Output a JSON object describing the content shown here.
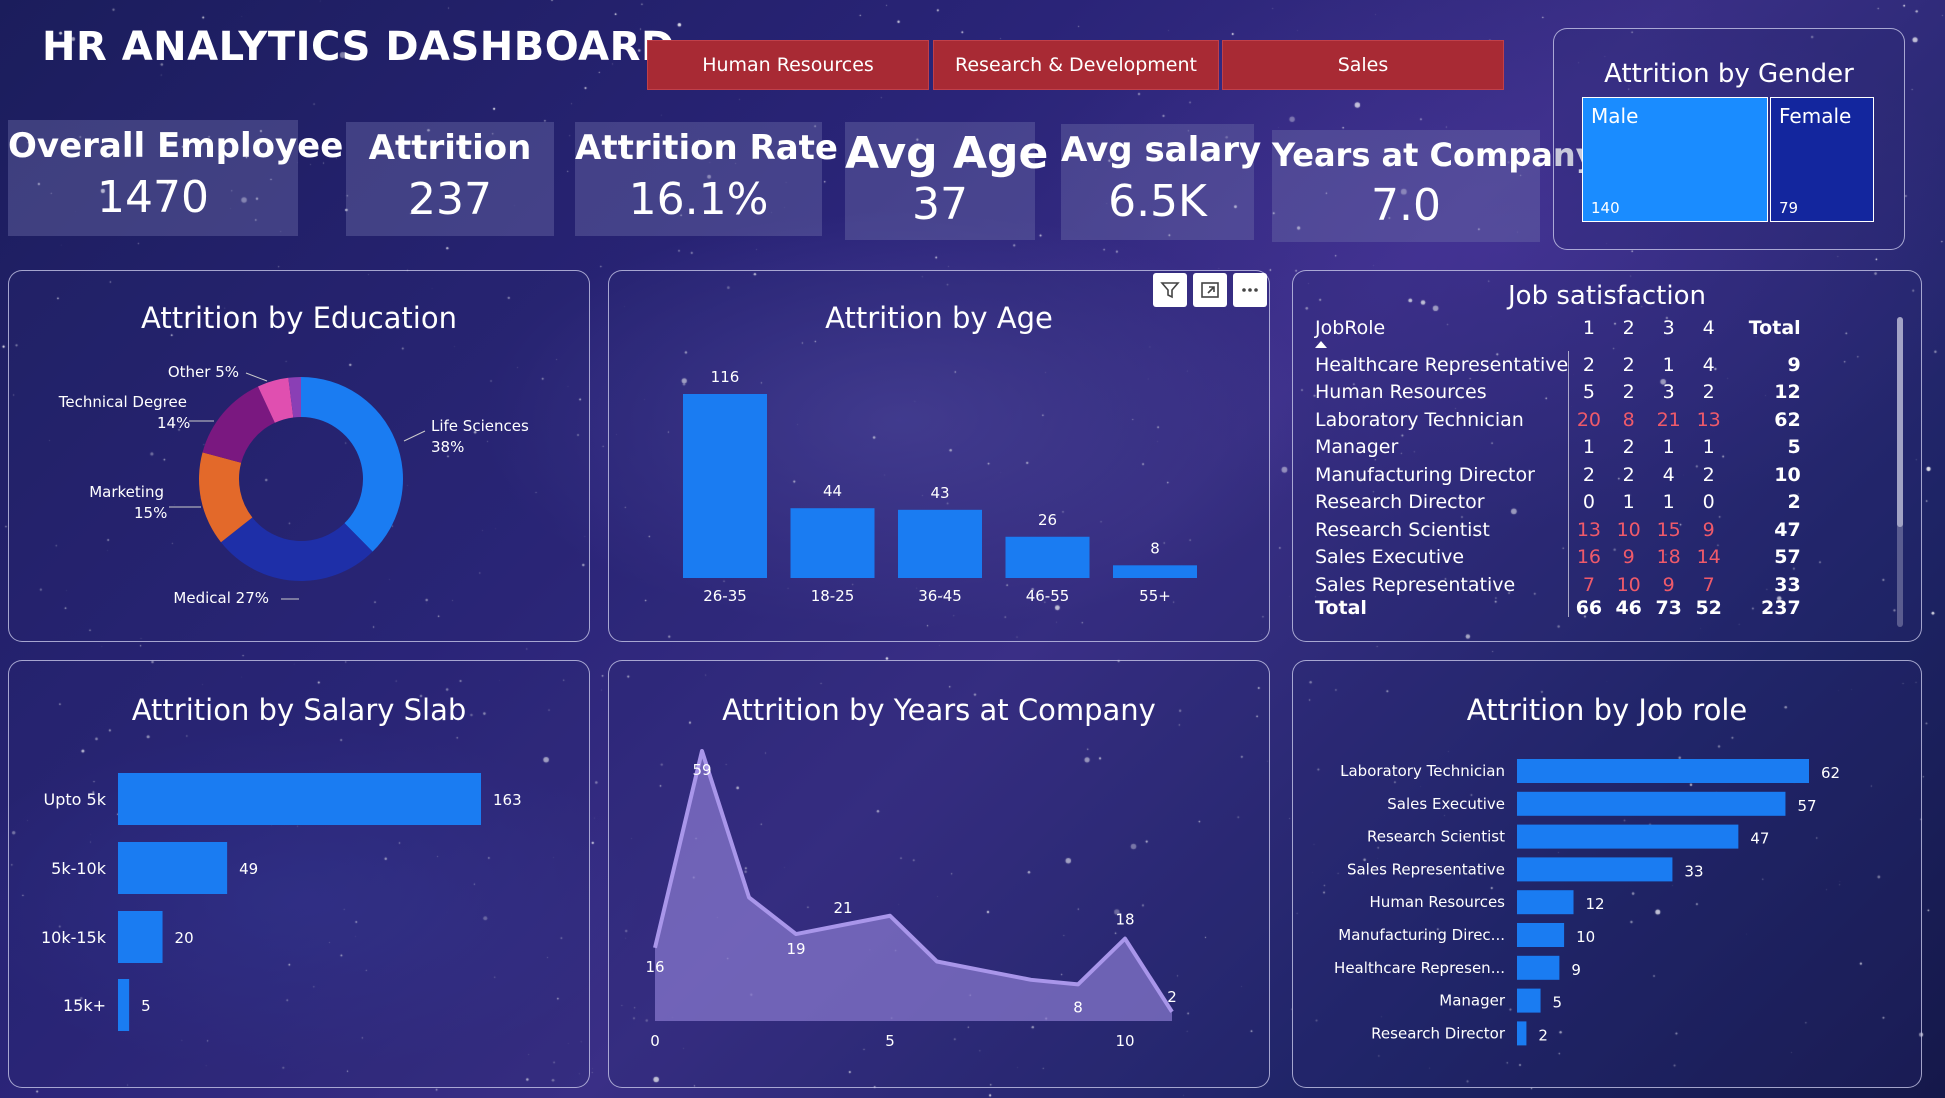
{
  "dashboard": {
    "title": "HR ANALYTICS DASHBOARD",
    "departments": [
      "Human Resources",
      "Research & Development",
      "Sales"
    ]
  },
  "kpis": [
    {
      "label": "Overall Employee",
      "value": "1470"
    },
    {
      "label": "Attrition",
      "value": "237"
    },
    {
      "label": "Attrition Rate",
      "value": "16.1%"
    },
    {
      "label": "Avg Age",
      "value": "37"
    },
    {
      "label": "Avg salary",
      "value": "6.5K"
    },
    {
      "label": "Years at Company",
      "value": "7.0"
    }
  ],
  "colors": {
    "bar_blue": "#1a7cf2",
    "donut": [
      "#1a7cf2",
      "#1e2fa8",
      "#e3692a",
      "#7a1880",
      "#e04fb0",
      "#8a3fb5"
    ],
    "area_fill": "#8a7ad0",
    "area_line": "#a996ea",
    "gender_male": "#1a8cff",
    "gender_female": "#13269e",
    "dept_button": "#a82a34"
  },
  "chart_data": [
    {
      "id": "gender",
      "type": "treemap",
      "title": "Attrition by Gender",
      "categories": [
        "Male",
        "Female"
      ],
      "values": [
        140,
        79
      ]
    },
    {
      "id": "education",
      "type": "pie",
      "title": "Attrition by Education",
      "categories": [
        "Life Sciences",
        "Medical",
        "Marketing",
        "Technical Degree",
        "Other",
        ""
      ],
      "values": [
        38,
        27,
        15,
        14,
        5,
        2
      ],
      "labels": [
        "Life Sciences 38%",
        "Medical 27%",
        "Marketing 15%",
        "Technical Degree 14%",
        "Other 5%"
      ]
    },
    {
      "id": "age",
      "type": "bar",
      "title": "Attrition by Age",
      "categories": [
        "26-35",
        "18-25",
        "36-45",
        "46-55",
        "55+"
      ],
      "values": [
        116,
        44,
        43,
        26,
        8
      ]
    },
    {
      "id": "job_satisfaction",
      "type": "table",
      "title": "Job satisfaction",
      "columns": [
        "JobRole",
        "1",
        "2",
        "3",
        "4",
        "Total"
      ],
      "rows": [
        {
          "role": "Healthcare Representative",
          "vals": [
            2,
            2,
            1,
            4
          ],
          "total": 9
        },
        {
          "role": "Human Resources",
          "vals": [
            5,
            2,
            3,
            2
          ],
          "total": 12
        },
        {
          "role": "Laboratory Technician",
          "vals": [
            20,
            8,
            21,
            13
          ],
          "total": 62
        },
        {
          "role": "Manager",
          "vals": [
            1,
            2,
            1,
            1
          ],
          "total": 5
        },
        {
          "role": "Manufacturing Director",
          "vals": [
            2,
            2,
            4,
            2
          ],
          "total": 10
        },
        {
          "role": "Research Director",
          "vals": [
            0,
            1,
            1,
            0
          ],
          "total": 2
        },
        {
          "role": "Research Scientist",
          "vals": [
            13,
            10,
            15,
            9
          ],
          "total": 47
        },
        {
          "role": "Sales Executive",
          "vals": [
            16,
            9,
            18,
            14
          ],
          "total": 57
        },
        {
          "role": "Sales Representative",
          "vals": [
            7,
            10,
            9,
            7
          ],
          "total": 33
        }
      ],
      "total_row": {
        "role": "Total",
        "vals": [
          66,
          46,
          73,
          52
        ],
        "total": 237
      }
    },
    {
      "id": "salary",
      "type": "bar",
      "orientation": "horizontal",
      "title": "Attrition by Salary Slab",
      "categories": [
        "Upto 5k",
        "5k-10k",
        "10k-15k",
        "15k+"
      ],
      "values": [
        163,
        49,
        20,
        5
      ]
    },
    {
      "id": "years",
      "type": "area",
      "title": "Attrition by Years at Company",
      "x": [
        0,
        1,
        2,
        3,
        4,
        5,
        6,
        7,
        8,
        9,
        10,
        11
      ],
      "y": [
        16,
        59,
        27,
        19,
        21,
        23,
        13,
        11,
        9,
        8,
        18,
        2
      ],
      "x_ticks": [
        0,
        5,
        10
      ],
      "point_labels": [
        0,
        1,
        3,
        4,
        9,
        10,
        11
      ]
    },
    {
      "id": "jobrole",
      "type": "bar",
      "orientation": "horizontal",
      "title": "Attrition by Job role",
      "categories": [
        "Laboratory Technician",
        "Sales Executive",
        "Research Scientist",
        "Sales Representative",
        "Human Resources",
        "Manufacturing Direc...",
        "Healthcare Represen...",
        "Manager",
        "Research Director"
      ],
      "values": [
        62,
        57,
        47,
        33,
        12,
        10,
        9,
        5,
        2
      ]
    }
  ]
}
